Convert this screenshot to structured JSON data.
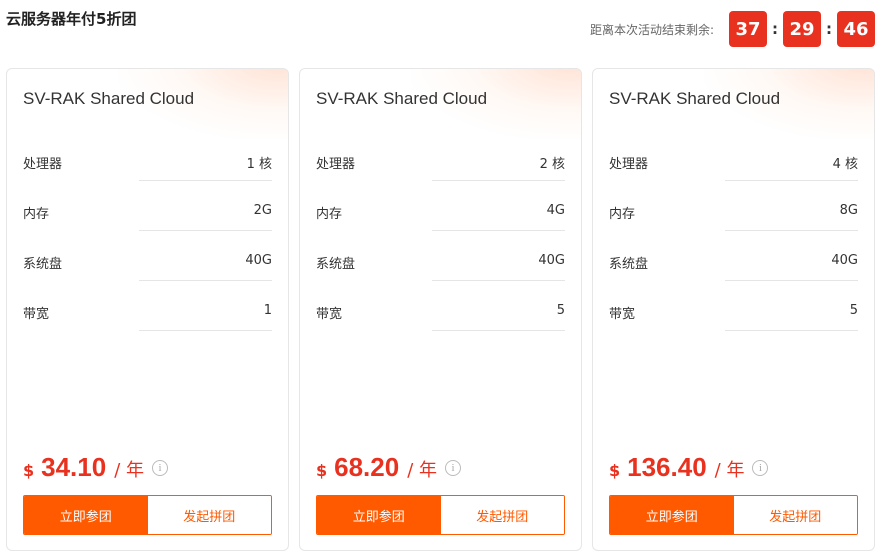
{
  "header": {
    "title": "云服务器年付5折团",
    "countdown_label": "距离本次活动结束剩余:",
    "hours": "37",
    "minutes": "29",
    "seconds": "46",
    "separator": ":"
  },
  "labels": {
    "cpu": "处理器",
    "memory": "内存",
    "disk": "系统盘",
    "bandwidth": "带宽",
    "currency": "$",
    "unit": "/ 年",
    "info": "i",
    "join_button": "立即参团",
    "start_button": "发起拼团"
  },
  "cards": [
    {
      "title": "SV-RAK Shared Cloud",
      "cpu": "1 核",
      "memory": "2G",
      "disk": "40G",
      "bandwidth": "1",
      "price": "34.10"
    },
    {
      "title": "SV-RAK Shared Cloud",
      "cpu": "2 核",
      "memory": "4G",
      "disk": "40G",
      "bandwidth": "5",
      "price": "68.20"
    },
    {
      "title": "SV-RAK Shared Cloud",
      "cpu": "4 核",
      "memory": "8G",
      "disk": "40G",
      "bandwidth": "5",
      "price": "136.40"
    }
  ],
  "colors": {
    "accent": "#ff5a00",
    "price": "#e8321f",
    "timer_bg": "#e8321f"
  }
}
